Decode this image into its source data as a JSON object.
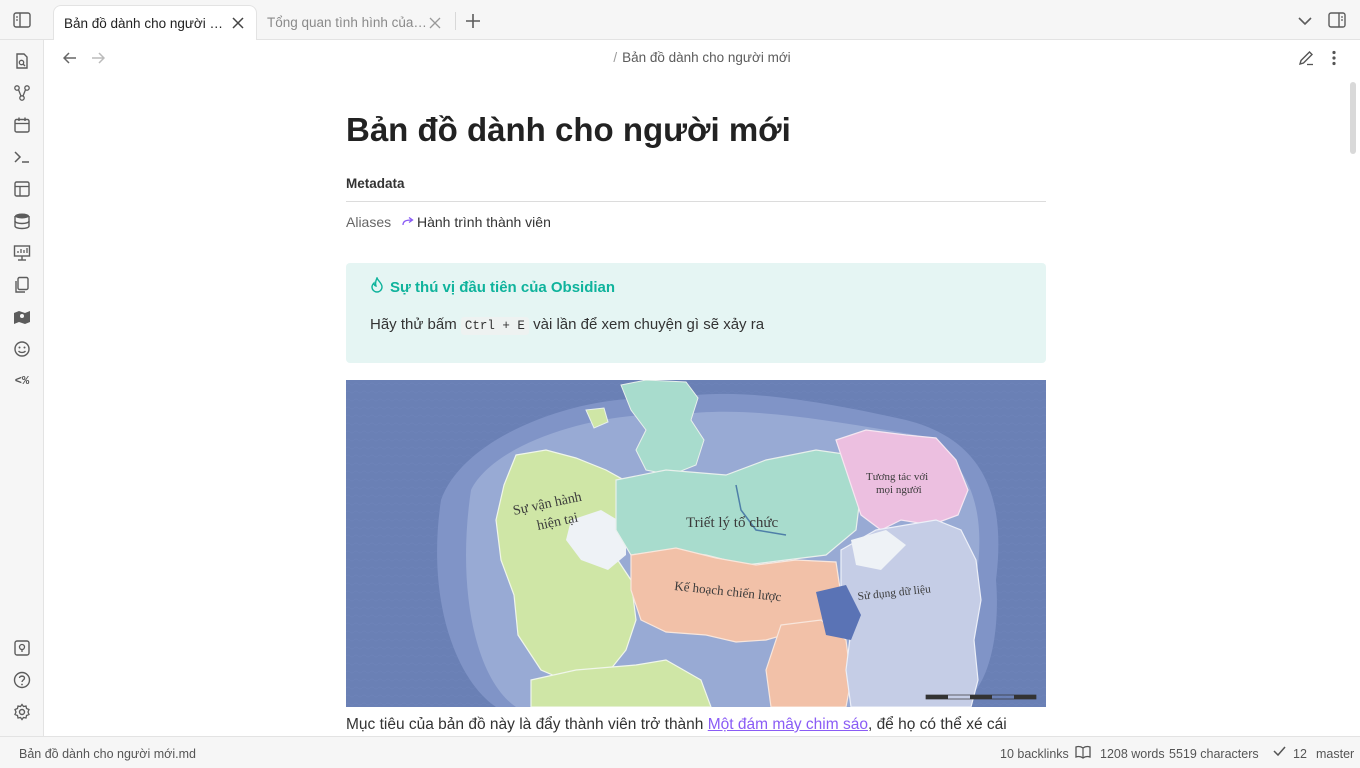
{
  "tabs": [
    {
      "label": "Bản đồ dành cho người mới"
    },
    {
      "label": "Tổng quan tình hình của ..."
    }
  ],
  "breadcrumb": {
    "separator": "/",
    "title": "Bản đồ dành cho người mới"
  },
  "note": {
    "title": "Bản đồ dành cho người mới",
    "metadata_label": "Metadata",
    "aliases_key": "Aliases",
    "aliases_value": "Hành trình thành viên",
    "callout": {
      "title": "Sự thú vị đầu tiên của Obsidian",
      "body_before": "Hãy thử bấm",
      "shortcut": "Ctrl + E",
      "body_after": "vài lần để xem chuyện gì sẽ xảy ra"
    },
    "map_labels": {
      "region_1": "Sự vận hành",
      "region_1b": "hiện tại",
      "region_2": "Triết lý tổ chức",
      "region_3": "Tương tác với",
      "region_3b": "mọi người",
      "region_4": "Kế hoạch chiến lược",
      "region_5": "Sử dụng dữ liệu"
    },
    "paragraph_before": "Mục tiêu của bản đồ này là đẩy thành viên trở thành ",
    "paragraph_link": "Một đám mây chim sáo",
    "paragraph_after": ", để họ có thể xé cái"
  },
  "statusbar": {
    "filename": "Bản đồ dành cho người mới.md",
    "backlinks": "10 backlinks",
    "words": "1208 words",
    "characters": "5519 characters",
    "sync_count": "12",
    "branch": "master"
  },
  "colors": {
    "accent": "#8a5cf5",
    "callout_bg": "#e5f5f3",
    "callout_title": "#0fb39c",
    "map_sea": "#6a80b5"
  },
  "icons": {
    "ribbon_top": [
      "file-search-icon",
      "graph-icon",
      "calendar-icon",
      "terminal-icon",
      "layout-icon",
      "database-icon",
      "presentation-icon",
      "copy-icon",
      "map-icon",
      "smiley-icon",
      "templater-icon"
    ],
    "ribbon_bottom": [
      "vault-icon",
      "help-icon",
      "settings-icon"
    ]
  }
}
